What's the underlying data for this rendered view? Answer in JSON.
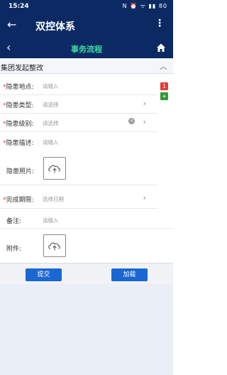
{
  "status_bar": {
    "time": "15:24",
    "icons_text": "N ⏰ ᯤ ▮▮ 80"
  },
  "app_bar": {
    "title": "双控体系"
  },
  "sub_bar": {
    "title": "事务流程"
  },
  "section": {
    "title": "集团发起整改"
  },
  "form": {
    "location": {
      "label": "隐患地点:",
      "placeholder": "请输入"
    },
    "type": {
      "label": "隐患类型:",
      "placeholder": "请选择"
    },
    "level": {
      "label": "隐患级别:",
      "placeholder": "请选择"
    },
    "desc": {
      "label": "隐患描述:",
      "placeholder": "请输入"
    },
    "photo": {
      "label": "隐患照片:"
    },
    "deadline": {
      "label": "完成期限:",
      "placeholder": "选择日期"
    },
    "remark": {
      "label": "备注:",
      "placeholder": "请输入"
    },
    "attachment": {
      "label": "附件:"
    }
  },
  "side": {
    "minus": "1",
    "plus": "+"
  },
  "actions": {
    "submit": "提交",
    "load": "加载"
  },
  "colors": {
    "primary": "#0b2a63",
    "accent": "#3ed8a0",
    "button": "#1a67d2",
    "required": "#e53935"
  }
}
